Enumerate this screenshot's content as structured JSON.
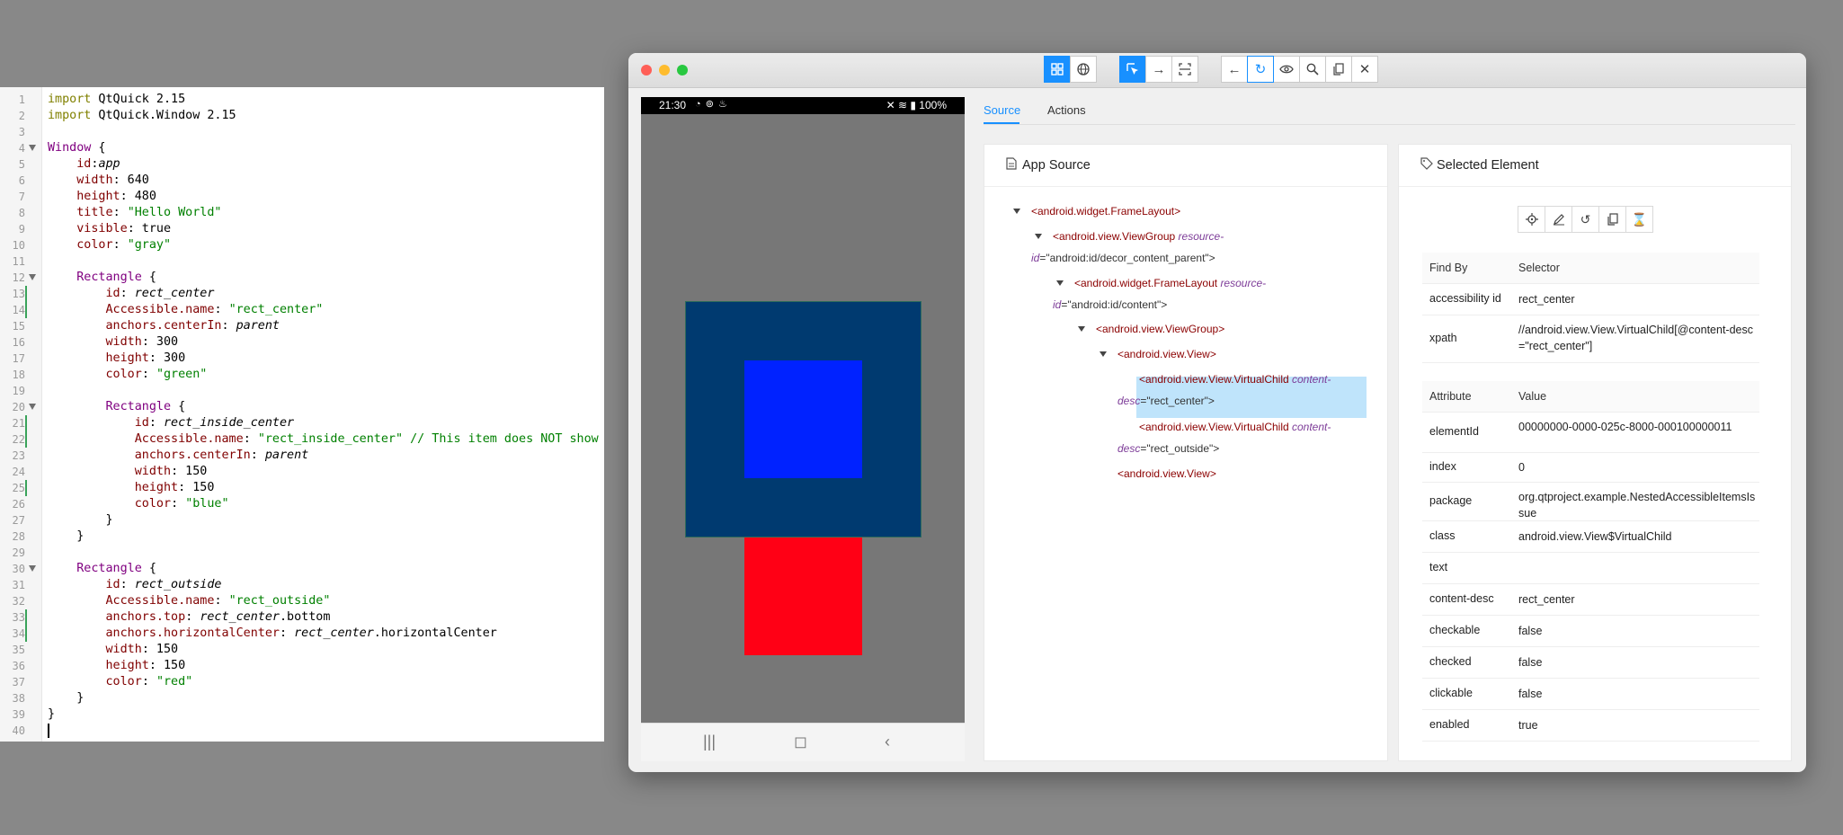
{
  "editor": {
    "lines": [
      {
        "n": "1",
        "fold": false,
        "mod": false,
        "parts": [
          [
            "kw",
            "import"
          ],
          [
            "p",
            " QtQuick 2.15"
          ]
        ]
      },
      {
        "n": "2",
        "fold": false,
        "mod": false,
        "parts": [
          [
            "kw",
            "import"
          ],
          [
            "p",
            " QtQuick.Window 2.15"
          ]
        ]
      },
      {
        "n": "3",
        "fold": false,
        "mod": false,
        "parts": []
      },
      {
        "n": "4",
        "fold": true,
        "mod": false,
        "parts": [
          [
            "type",
            "Window"
          ],
          [
            "p",
            " {"
          ]
        ]
      },
      {
        "n": "5",
        "fold": false,
        "mod": false,
        "parts": [
          [
            "p",
            "    "
          ],
          [
            "prop",
            "id"
          ],
          [
            "p",
            ":"
          ],
          [
            "it",
            "app"
          ]
        ]
      },
      {
        "n": "6",
        "fold": false,
        "mod": false,
        "parts": [
          [
            "p",
            "    "
          ],
          [
            "prop",
            "width"
          ],
          [
            "p",
            ": 640"
          ]
        ]
      },
      {
        "n": "7",
        "fold": false,
        "mod": false,
        "parts": [
          [
            "p",
            "    "
          ],
          [
            "prop",
            "height"
          ],
          [
            "p",
            ": 480"
          ]
        ]
      },
      {
        "n": "8",
        "fold": false,
        "mod": false,
        "parts": [
          [
            "p",
            "    "
          ],
          [
            "prop",
            "title"
          ],
          [
            "p",
            ": "
          ],
          [
            "str",
            "\"Hello World\""
          ]
        ]
      },
      {
        "n": "9",
        "fold": false,
        "mod": false,
        "parts": [
          [
            "p",
            "    "
          ],
          [
            "prop",
            "visible"
          ],
          [
            "p",
            ": true"
          ]
        ]
      },
      {
        "n": "10",
        "fold": false,
        "mod": false,
        "parts": [
          [
            "p",
            "    "
          ],
          [
            "prop",
            "color"
          ],
          [
            "p",
            ": "
          ],
          [
            "str",
            "\"gray\""
          ]
        ]
      },
      {
        "n": "11",
        "fold": false,
        "mod": false,
        "parts": []
      },
      {
        "n": "12",
        "fold": true,
        "mod": false,
        "parts": [
          [
            "p",
            "    "
          ],
          [
            "type",
            "Rectangle"
          ],
          [
            "p",
            " {"
          ]
        ]
      },
      {
        "n": "13",
        "fold": false,
        "mod": true,
        "parts": [
          [
            "p",
            "        "
          ],
          [
            "prop",
            "id"
          ],
          [
            "p",
            ": "
          ],
          [
            "it",
            "rect_center"
          ]
        ]
      },
      {
        "n": "14",
        "fold": false,
        "mod": true,
        "parts": [
          [
            "p",
            "        "
          ],
          [
            "prop",
            "Accessible.name"
          ],
          [
            "p",
            ": "
          ],
          [
            "str",
            "\"rect_center\""
          ]
        ]
      },
      {
        "n": "15",
        "fold": false,
        "mod": false,
        "parts": [
          [
            "p",
            "        "
          ],
          [
            "prop",
            "anchors.centerIn"
          ],
          [
            "p",
            ": "
          ],
          [
            "it",
            "parent"
          ]
        ]
      },
      {
        "n": "16",
        "fold": false,
        "mod": false,
        "parts": [
          [
            "p",
            "        "
          ],
          [
            "prop",
            "width"
          ],
          [
            "p",
            ": 300"
          ]
        ]
      },
      {
        "n": "17",
        "fold": false,
        "mod": false,
        "parts": [
          [
            "p",
            "        "
          ],
          [
            "prop",
            "height"
          ],
          [
            "p",
            ": 300"
          ]
        ]
      },
      {
        "n": "18",
        "fold": false,
        "mod": false,
        "parts": [
          [
            "p",
            "        "
          ],
          [
            "prop",
            "color"
          ],
          [
            "p",
            ": "
          ],
          [
            "str",
            "\"green\""
          ]
        ]
      },
      {
        "n": "19",
        "fold": false,
        "mod": false,
        "parts": []
      },
      {
        "n": "20",
        "fold": true,
        "mod": false,
        "parts": [
          [
            "p",
            "        "
          ],
          [
            "type",
            "Rectangle"
          ],
          [
            "p",
            " {"
          ]
        ]
      },
      {
        "n": "21",
        "fold": false,
        "mod": true,
        "parts": [
          [
            "p",
            "            "
          ],
          [
            "prop",
            "id"
          ],
          [
            "p",
            ": "
          ],
          [
            "it",
            "rect_inside_center"
          ]
        ]
      },
      {
        "n": "22",
        "fold": false,
        "mod": true,
        "parts": [
          [
            "p",
            "            "
          ],
          [
            "prop",
            "Accessible.name"
          ],
          [
            "p",
            ": "
          ],
          [
            "str",
            "\"rect_inside_center\" // This item does NOT show up"
          ]
        ]
      },
      {
        "n": "23",
        "fold": false,
        "mod": false,
        "parts": [
          [
            "p",
            "            "
          ],
          [
            "prop",
            "anchors.centerIn"
          ],
          [
            "p",
            ": "
          ],
          [
            "it",
            "parent"
          ]
        ]
      },
      {
        "n": "24",
        "fold": false,
        "mod": false,
        "parts": [
          [
            "p",
            "            "
          ],
          [
            "prop",
            "width"
          ],
          [
            "p",
            ": 150"
          ]
        ]
      },
      {
        "n": "25",
        "fold": false,
        "mod": true,
        "parts": [
          [
            "p",
            "            "
          ],
          [
            "prop",
            "height"
          ],
          [
            "p",
            ": 150"
          ]
        ]
      },
      {
        "n": "26",
        "fold": false,
        "mod": false,
        "parts": [
          [
            "p",
            "            "
          ],
          [
            "prop",
            "color"
          ],
          [
            "p",
            ": "
          ],
          [
            "str",
            "\"blue\""
          ]
        ]
      },
      {
        "n": "27",
        "fold": false,
        "mod": false,
        "parts": [
          [
            "p",
            "        }"
          ]
        ]
      },
      {
        "n": "28",
        "fold": false,
        "mod": false,
        "parts": [
          [
            "p",
            "    }"
          ]
        ]
      },
      {
        "n": "29",
        "fold": false,
        "mod": false,
        "parts": []
      },
      {
        "n": "30",
        "fold": true,
        "mod": false,
        "parts": [
          [
            "p",
            "    "
          ],
          [
            "type",
            "Rectangle"
          ],
          [
            "p",
            " {"
          ]
        ]
      },
      {
        "n": "31",
        "fold": false,
        "mod": false,
        "parts": [
          [
            "p",
            "        "
          ],
          [
            "prop",
            "id"
          ],
          [
            "p",
            ": "
          ],
          [
            "it",
            "rect_outside"
          ]
        ]
      },
      {
        "n": "32",
        "fold": false,
        "mod": false,
        "parts": [
          [
            "p",
            "        "
          ],
          [
            "prop",
            "Accessible.name"
          ],
          [
            "p",
            ": "
          ],
          [
            "str",
            "\"rect_outside\""
          ]
        ]
      },
      {
        "n": "33",
        "fold": false,
        "mod": true,
        "parts": [
          [
            "p",
            "        "
          ],
          [
            "prop",
            "anchors.top"
          ],
          [
            "p",
            ": "
          ],
          [
            "it",
            "rect_center"
          ],
          [
            "p",
            ".bottom"
          ]
        ]
      },
      {
        "n": "34",
        "fold": false,
        "mod": true,
        "parts": [
          [
            "p",
            "        "
          ],
          [
            "prop",
            "anchors.horizontalCenter"
          ],
          [
            "p",
            ": "
          ],
          [
            "it",
            "rect_center"
          ],
          [
            "p",
            ".horizontalCenter"
          ]
        ]
      },
      {
        "n": "35",
        "fold": false,
        "mod": false,
        "parts": [
          [
            "p",
            "        "
          ],
          [
            "prop",
            "width"
          ],
          [
            "p",
            ": 150"
          ]
        ]
      },
      {
        "n": "36",
        "fold": false,
        "mod": false,
        "parts": [
          [
            "p",
            "        "
          ],
          [
            "prop",
            "height"
          ],
          [
            "p",
            ": 150"
          ]
        ]
      },
      {
        "n": "37",
        "fold": false,
        "mod": false,
        "parts": [
          [
            "p",
            "        "
          ],
          [
            "prop",
            "color"
          ],
          [
            "p",
            ": "
          ],
          [
            "str",
            "\"red\""
          ]
        ]
      },
      {
        "n": "38",
        "fold": false,
        "mod": false,
        "parts": [
          [
            "p",
            "    }"
          ]
        ]
      },
      {
        "n": "39",
        "fold": false,
        "mod": false,
        "parts": [
          [
            "p",
            "}"
          ]
        ]
      },
      {
        "n": "40",
        "fold": false,
        "mod": false,
        "parts": []
      }
    ]
  },
  "toolbar": {
    "group1": [
      "grid-icon",
      "globe-icon"
    ],
    "group2": [
      "select-element-icon",
      "swipe-icon",
      "tap-by-coordinates-icon"
    ],
    "group3": [
      "back-icon",
      "refresh-icon",
      "eye-icon",
      "search-icon",
      "copy-icon",
      "close-icon"
    ]
  },
  "device": {
    "status_time": "21:30",
    "status_icons": "◔ ⊚ ♨",
    "status_right": "✕ ≋ ▮ 100%",
    "nav": [
      "|||",
      "◻",
      "‹"
    ],
    "rect_colors": {
      "outer": "#003a70",
      "inner": "#0022ff",
      "outside": "#ff0015",
      "screen": "#777777"
    }
  },
  "tabs": {
    "source": "Source",
    "actions": "Actions"
  },
  "source_panel": {
    "title": "App Source",
    "tree": [
      {
        "arrow": true,
        "lines": [
          [
            [
              "tag",
              "<android.widget.FrameLayout>"
            ]
          ]
        ]
      },
      {
        "arrow": true,
        "lines": [
          [
            [
              "tag",
              "<android.view.ViewGroup "
            ],
            [
              "attr",
              "resource-"
            ]
          ],
          [
            [
              "attr",
              "id"
            ],
            [
              "val",
              "=\"android:id/decor_content_parent\">"
            ]
          ]
        ]
      },
      {
        "arrow": true,
        "lines": [
          [
            [
              "tag",
              "<android.widget.FrameLayout "
            ],
            [
              "attr",
              "resource-"
            ]
          ],
          [
            [
              "attr",
              "id"
            ],
            [
              "val",
              "=\"android:id/content\">"
            ]
          ]
        ]
      },
      {
        "arrow": true,
        "lines": [
          [
            [
              "tag",
              "<android.view.ViewGroup>"
            ]
          ]
        ]
      },
      {
        "arrow": true,
        "lines": [
          [
            [
              "tag",
              "<android.view.View>"
            ]
          ]
        ]
      },
      {
        "arrow": false,
        "lines": [
          [
            [
              "tag",
              "<android.view.View.VirtualChild "
            ],
            [
              "attr",
              "content-"
            ]
          ],
          [
            [
              "attr",
              "desc"
            ],
            [
              "val",
              "=\"rect_center\">"
            ]
          ]
        ]
      },
      {
        "arrow": false,
        "lines": [
          [
            [
              "tag",
              "<android.view.View.VirtualChild "
            ],
            [
              "attr",
              "content-"
            ]
          ],
          [
            [
              "attr",
              "desc"
            ],
            [
              "val",
              "=\"rect_outside\">"
            ]
          ]
        ]
      },
      {
        "arrow": false,
        "lines": [
          [
            [
              "tag",
              "<android.view.View>"
            ]
          ]
        ]
      }
    ]
  },
  "selected_panel": {
    "title": "Selected Element",
    "tools": [
      "tap-icon",
      "edit-icon",
      "clear-icon",
      "copy-icon",
      "timer-icon"
    ],
    "find_header": {
      "a": "Find By",
      "b": "Selector"
    },
    "find_rows": [
      {
        "a": "accessibility id",
        "b": "rect_center"
      },
      {
        "a": "xpath",
        "b": "//android.view.View.VirtualChild[@content-desc=\"rect_center\"]"
      }
    ],
    "attr_header": {
      "a": "Attribute",
      "b": "Value"
    },
    "attr_rows": [
      {
        "a": "elementId",
        "b": "00000000-0000-025c-8000-000100000011"
      },
      {
        "a": "index",
        "b": "0"
      },
      {
        "a": "package",
        "b": "org.qtproject.example.NestedAccessibleItemsIssue"
      },
      {
        "a": "class",
        "b": "android.view.View$VirtualChild"
      },
      {
        "a": "text",
        "b": ""
      },
      {
        "a": "content-desc",
        "b": "rect_center"
      },
      {
        "a": "checkable",
        "b": "false"
      },
      {
        "a": "checked",
        "b": "false"
      },
      {
        "a": "clickable",
        "b": "false"
      },
      {
        "a": "enabled",
        "b": "true"
      }
    ]
  }
}
